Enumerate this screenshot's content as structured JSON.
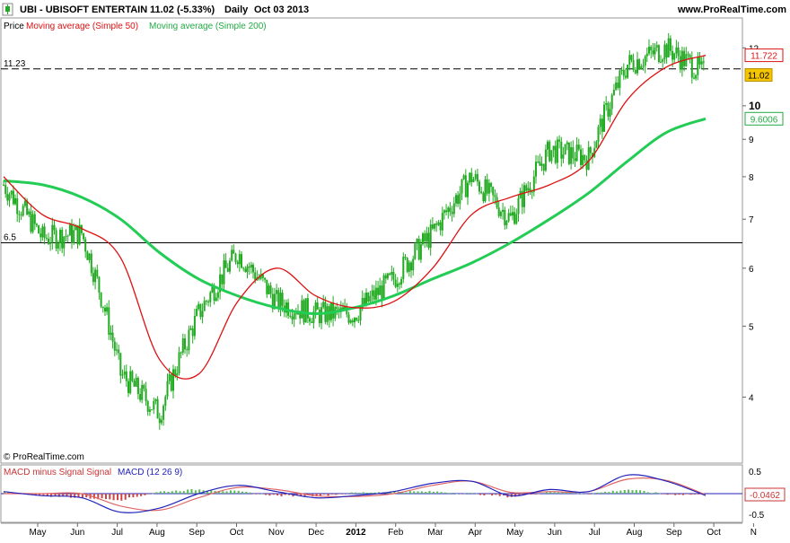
{
  "header": {
    "ticker": "UBI",
    "title": "UBI - UBISOFT ENTERTAIN",
    "quote": "11.02 (-5.33%)",
    "interval": "Daily",
    "date": "Oct 03 2013",
    "website": "www.ProRealTime.com"
  },
  "legend": {
    "price": "Price",
    "ma50": "Moving average (Simple 50)",
    "ma200": "Moving average (Simple 200)"
  },
  "copyright": "© ProRealTime.com",
  "macd_legend": {
    "histogram": "MACD minus Signal Signal",
    "macd": "MACD (12 26 9)"
  },
  "colors": {
    "candle": "#22aa22",
    "ma50": "#dd1111",
    "ma200": "#22cc55",
    "macd_line": "#2222bb",
    "signal_line": "#e06666",
    "hist_pos": "#55bb55",
    "hist_neg": "#cc4444",
    "last_price_box": "#f5c400"
  },
  "chart_data": [
    {
      "type": "line",
      "scale": "log",
      "ylim": [
        3.4,
        12.6
      ],
      "yticks": [
        4,
        5,
        6,
        7,
        8,
        9,
        10,
        12
      ],
      "xticks": [
        "May",
        "Jun",
        "Jul",
        "Aug",
        "Sep",
        "Oct",
        "Nov",
        "Dec",
        "2012",
        "Feb",
        "Mar",
        "Apr",
        "May",
        "Jun",
        "Jul",
        "Aug",
        "Sep",
        "Oct",
        "N"
      ],
      "x": [
        "Apr 2011",
        "May",
        "Jun",
        "Jul",
        "Aug",
        "Sep",
        "Oct",
        "Nov",
        "Dec",
        "Jan 2012",
        "Feb",
        "Mar",
        "Apr",
        "May",
        "Jun",
        "Jul",
        "Aug",
        "Sep",
        "Oct"
      ],
      "series": [
        {
          "name": "Price",
          "values": [
            7.8,
            6.6,
            6.7,
            4.3,
            3.8,
            5.2,
            6.3,
            5.4,
            5.2,
            5.2,
            5.8,
            6.7,
            8.0,
            7.0,
            8.7,
            8.5,
            11.4,
            12.0,
            11.02
          ]
        },
        {
          "name": "Moving average (Simple 50)",
          "values": [
            8.0,
            7.1,
            6.8,
            6.2,
            4.5,
            4.3,
            5.4,
            6.0,
            5.5,
            5.3,
            5.4,
            6.0,
            7.1,
            7.5,
            7.8,
            8.4,
            10.2,
            11.3,
            11.722
          ]
        },
        {
          "name": "Moving average (Simple 200)",
          "values": [
            7.9,
            7.8,
            7.5,
            7.0,
            6.3,
            5.8,
            5.5,
            5.3,
            5.2,
            5.3,
            5.5,
            5.8,
            6.1,
            6.5,
            7.0,
            7.6,
            8.4,
            9.2,
            9.6006
          ]
        }
      ],
      "reference_lines": [
        {
          "label": "11.23",
          "value": 11.23,
          "style": "dashed"
        },
        {
          "label": "6.5",
          "value": 6.5,
          "style": "solid"
        }
      ],
      "last_values": {
        "price": "11.02",
        "ma50": "11.722",
        "ma200": "9.6006"
      },
      "grid": false
    },
    {
      "type": "bar",
      "title": "MACD (12 26 9)",
      "ylim": [
        -0.5,
        0.5
      ],
      "yticks": [
        0.5,
        -0.5
      ],
      "x": [
        "Apr 2011",
        "May",
        "Jun",
        "Jul",
        "Aug",
        "Sep",
        "Oct",
        "Nov",
        "Dec",
        "Jan 2012",
        "Feb",
        "Mar",
        "Apr",
        "May",
        "Jun",
        "Jul",
        "Aug",
        "Sep",
        "Oct"
      ],
      "series": [
        {
          "name": "MACD",
          "values": [
            0.05,
            -0.05,
            -0.1,
            -0.45,
            -0.35,
            0.0,
            0.2,
            0.05,
            -0.1,
            -0.05,
            0.05,
            0.25,
            0.3,
            -0.05,
            0.1,
            0.05,
            0.45,
            0.3,
            -0.0462
          ]
        },
        {
          "name": "MACD minus Signal",
          "values": [
            0.05,
            -0.05,
            -0.1,
            -0.15,
            0.05,
            0.1,
            0.05,
            -0.05,
            -0.05,
            0.02,
            0.05,
            0.05,
            0.0,
            -0.08,
            0.05,
            0.0,
            0.1,
            -0.02,
            -0.02
          ]
        }
      ],
      "last_value": "-0.0462"
    }
  ]
}
